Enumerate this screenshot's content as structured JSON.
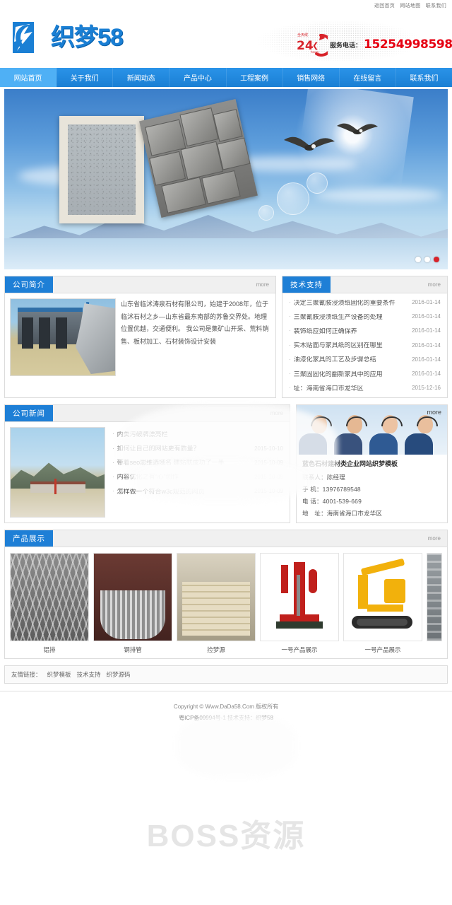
{
  "topbar": {
    "links": [
      "返回首页",
      "网站地图",
      "联系我们"
    ]
  },
  "header": {
    "logo_text": "织梦58",
    "badge_top": "全天候",
    "badge_num": "24",
    "badge_unit": "hours",
    "service_label": "服务电话：",
    "service_phone": "15254998598"
  },
  "nav": {
    "items": [
      {
        "label": "网站首页",
        "active": true
      },
      {
        "label": "关于我们",
        "active": false
      },
      {
        "label": "新闻动态",
        "active": false
      },
      {
        "label": "产品中心",
        "active": false
      },
      {
        "label": "工程案例",
        "active": false
      },
      {
        "label": "销售网络",
        "active": false
      },
      {
        "label": "在线留言",
        "active": false
      },
      {
        "label": "联系我们",
        "active": false
      }
    ]
  },
  "banner": {
    "slide_count": 3,
    "active_slide": 3
  },
  "about": {
    "title": "公司简介",
    "more": "more",
    "paragraph1": "山东省临沭涛泉石材有限公司，始建于2008年，位于临沭石材之乡—山东省最东南部的苏鲁交界处。地理位置优越，交通便利。",
    "paragraph2": "我公司是集矿山开采、荒料销售、板材加工、石材装饰设计安装"
  },
  "tech_support": {
    "title": "技术支持",
    "more": "more",
    "items": [
      {
        "title": "决定三聚氰胺浸渍纸固化的重要条件",
        "date": "2016-01-14"
      },
      {
        "title": "三聚氰胺浸渍纸生产设备的处理",
        "date": "2016-01-14"
      },
      {
        "title": "装饰纸应如何正确保养",
        "date": "2016-01-14"
      },
      {
        "title": "实木贴面与家具纸的区别在哪里",
        "date": "2016-01-14"
      },
      {
        "title": "油漆化家具的工艺及步骤总结",
        "date": "2016-01-14"
      },
      {
        "title": "三聚固固化的翻新家具中的应用",
        "date": "2016-01-14"
      },
      {
        "title": "址：海南省海口市龙华区",
        "date": "2015-12-16"
      }
    ]
  },
  "news": {
    "title": "公司新闻",
    "more": "more",
    "items": [
      {
        "title": "内类污破牌漂亮栏",
        "date": ""
      },
      {
        "title": "如何让自己的网站更有质量？",
        "date": "2015-10-10"
      },
      {
        "title": "带着seo思维选域名 建站就成功了一半",
        "date": "2015-10-09"
      },
      {
        "title": "内容优化之有“心”创作",
        "date": "2015-10-09"
      },
      {
        "title": "怎样做一个符合w3c规范的网页",
        "date": "2015-10-09"
      }
    ]
  },
  "contact": {
    "more": "more",
    "title": "蓝色石材建材类企业网站织梦模板",
    "lines": [
      "联系人：陈经理",
      "手 机：13976789548",
      "电 话：4001-539-669",
      "地　址：海南省海口市龙华区"
    ]
  },
  "products": {
    "title": "产品展示",
    "more": "more",
    "items": [
      {
        "caption": "铝排"
      },
      {
        "caption": "钢排管"
      },
      {
        "caption": "捡梦源"
      },
      {
        "caption": "一号产品展示"
      },
      {
        "caption": "一号产品展示"
      },
      {
        "caption": ""
      }
    ]
  },
  "friendly_links": {
    "label": "友情链接：",
    "links": [
      "织梦模板",
      "技术支持",
      "织梦源码"
    ]
  },
  "footer": {
    "copyright": "Copyright © Www.DaDa58.Com 版权所有",
    "icp": "粤ICP备09994号-1 技术支持：织梦58"
  },
  "watermark": {
    "text": "BOSS资源"
  },
  "colors": {
    "brand_blue": "#1e7fd6",
    "nav_blue": "#2a93e8",
    "active_nav": "#4fb0f5",
    "accent_red": "#e60012",
    "dot_active": "#d8232a"
  }
}
